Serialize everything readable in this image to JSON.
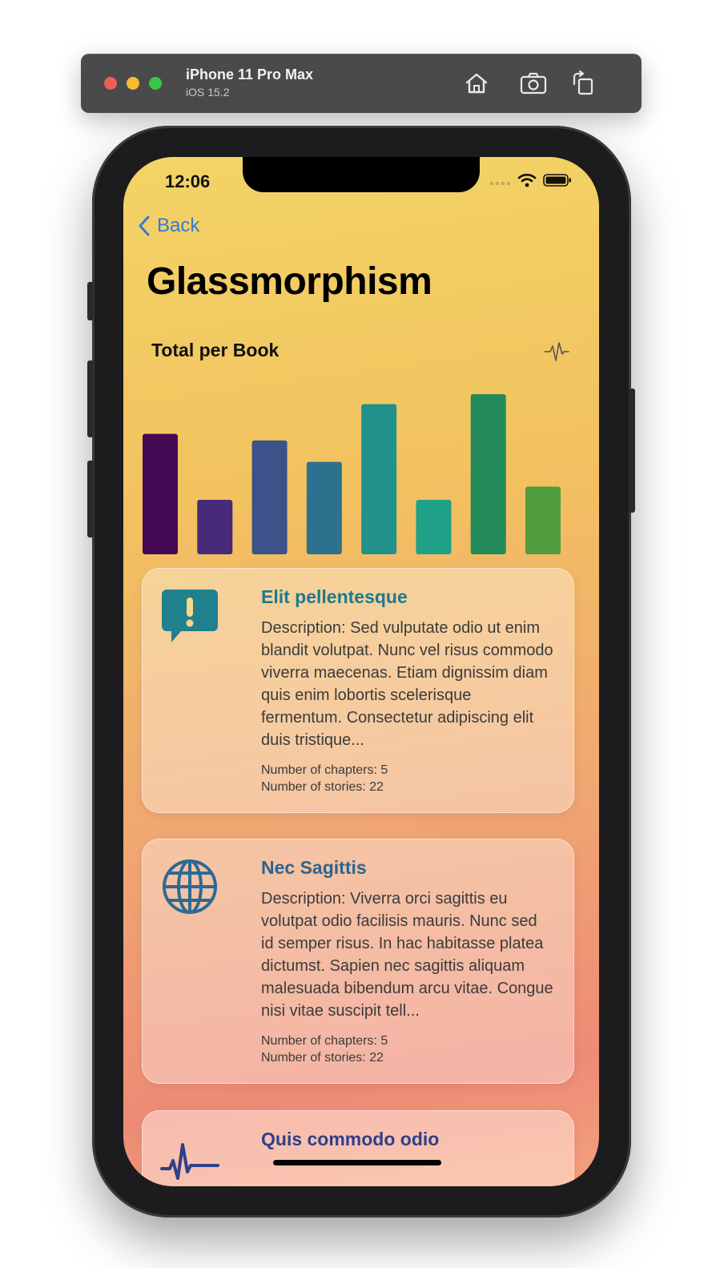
{
  "simulator": {
    "device": "iPhone 11 Pro Max",
    "os": "iOS 15.2",
    "icons": [
      "home-icon",
      "screenshot-icon",
      "rotate-icon"
    ]
  },
  "status_bar": {
    "time": "12:06"
  },
  "nav": {
    "back_label": "Back",
    "title": "Glassmorphism"
  },
  "chart_section": {
    "title": "Total per Book",
    "icon": "waveform-icon"
  },
  "chart_data": {
    "type": "bar",
    "categories": [
      "",
      "",
      "",
      "",
      "",
      "",
      "",
      ""
    ],
    "values": [
      73,
      33,
      69,
      56,
      91,
      33,
      97,
      41
    ],
    "colors": [
      "#440b54",
      "#472a7a",
      "#3b528b",
      "#2c728e",
      "#21918c",
      "#1fa188",
      "#238a5a",
      "#509c3f"
    ],
    "ylim": [
      0,
      100
    ],
    "grid": false,
    "title": ""
  },
  "cards": [
    {
      "title": "Elit pellentesque",
      "title_color": "#1f7a8c",
      "icon": "exclamation-bubble-icon",
      "icon_color": "#21808d",
      "description": "Description: Sed vulputate odio ut enim blandit volutpat. Nunc vel risus commodo viverra maecenas. Etiam dignissim diam quis enim lobortis scelerisque fermentum. Consectetur adipiscing elit duis tristique...",
      "chapters": "Number of chapters: 5",
      "stories": "Number of stories: 22"
    },
    {
      "title": "Nec Sagittis",
      "title_color": "#2c6590",
      "icon": "globe-icon",
      "icon_color": "#2d6a93",
      "description": "Description: Viverra orci sagittis eu volutpat odio facilisis mauris. Nunc sed id semper risus. In hac habitasse platea dictumst. Sapien nec sagittis aliquam malesuada bibendum arcu vitae. Congue nisi vitae suscipit tell...",
      "chapters": "Number of chapters: 5",
      "stories": "Number of stories: 22"
    },
    {
      "title": "Quis commodo odio",
      "title_color": "#2f3f8a",
      "icon": "waveform-icon"
    }
  ]
}
